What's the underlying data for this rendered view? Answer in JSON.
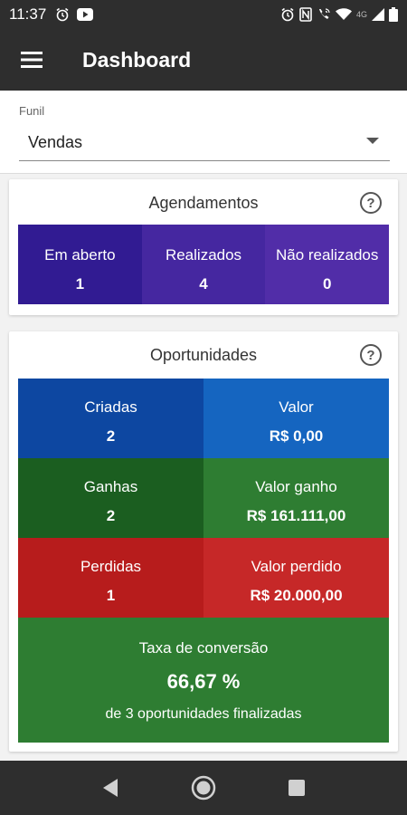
{
  "status_bar": {
    "time": "11:37",
    "left_icons": [
      "alarm-icon",
      "youtube-icon"
    ],
    "right_icons": [
      "alarm-icon",
      "nfc-icon",
      "wifi-call-icon",
      "wifi-icon",
      "signal-icon",
      "battery-icon"
    ],
    "network": "4G"
  },
  "app_bar": {
    "title": "Dashboard",
    "menu_icon": "menu-icon"
  },
  "funil": {
    "label": "Funil",
    "value": "Vendas"
  },
  "agendamentos": {
    "title": "Agendamentos",
    "items": [
      {
        "label": "Em aberto",
        "value": "1",
        "color": "#311b92"
      },
      {
        "label": "Realizados",
        "value": "4",
        "color": "#4527a0"
      },
      {
        "label": "Não realizados",
        "value": "0",
        "color": "#512da8"
      }
    ]
  },
  "oportunidades": {
    "title": "Oportunidades",
    "rows": [
      [
        {
          "label": "Criadas",
          "value": "2",
          "color": "#0d47a1"
        },
        {
          "label": "Valor",
          "value": "R$ 0,00",
          "color": "#1565c0"
        }
      ],
      [
        {
          "label": "Ganhas",
          "value": "2",
          "color": "#1b5e20"
        },
        {
          "label": "Valor ganho",
          "value": "R$ 161.111,00",
          "color": "#2e7d32"
        }
      ],
      [
        {
          "label": "Perdidas",
          "value": "1",
          "color": "#b71c1c"
        },
        {
          "label": "Valor perdido",
          "value": "R$ 20.000,00",
          "color": "#c62828"
        }
      ]
    ],
    "conversion": {
      "label": "Taxa de conversão",
      "value": "66,67 %",
      "subtitle": "de 3 oportunidades finalizadas"
    }
  },
  "help_symbol": "?"
}
